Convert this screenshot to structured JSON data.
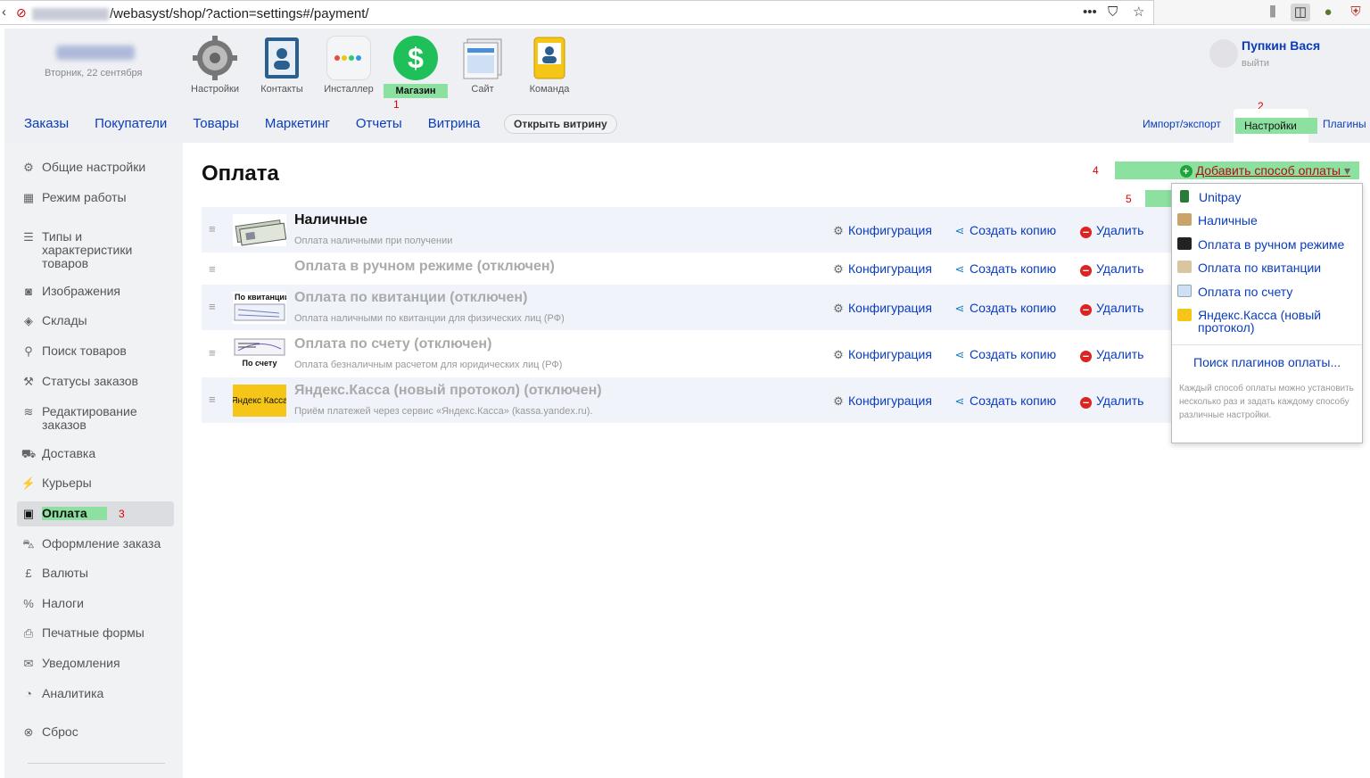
{
  "browser": {
    "url_path": "/webasyst/shop/?action=settings#/payment/",
    "icons": [
      "back-arrow-icon",
      "insecure-lock-icon",
      "more-dots-icon",
      "pocket-icon",
      "bookmark-star-icon",
      "library-icon",
      "sidebar-icon",
      "extension-icon",
      "shield-icon"
    ]
  },
  "account": {
    "date": "Вторник, 22 сентября"
  },
  "apps": [
    {
      "label": "Настройки",
      "icon": "gear-icon"
    },
    {
      "label": "Контакты",
      "icon": "contacts-icon"
    },
    {
      "label": "Инсталлер",
      "icon": "installer-icon"
    },
    {
      "label": "Магазин",
      "icon": "shop-dollar-icon"
    },
    {
      "label": "Сайт",
      "icon": "site-icon"
    },
    {
      "label": "Команда",
      "icon": "team-icon"
    }
  ],
  "user": {
    "name": "Пупкин Вася",
    "logout": "выйти"
  },
  "annotations": {
    "n1": "1",
    "n2": "2",
    "n3": "3",
    "n4": "4",
    "n5": "5"
  },
  "nav": {
    "items": [
      "Заказы",
      "Покупатели",
      "Товары",
      "Маркетинг",
      "Отчеты",
      "Витрина"
    ],
    "open_store": "Открыть витрину",
    "right": [
      "Импорт/экспорт",
      "Настройки",
      "Плагины"
    ]
  },
  "sidebar": {
    "items": [
      {
        "label": "Общие настройки",
        "icon": "settings-icon"
      },
      {
        "label": "Режим работы",
        "icon": "calendar-icon"
      },
      {
        "label": "Типы и характеристики товаров",
        "icon": "list-icon"
      },
      {
        "label": "Изображения",
        "icon": "camera-icon"
      },
      {
        "label": "Склады",
        "icon": "box-icon"
      },
      {
        "label": "Поиск товаров",
        "icon": "search-icon"
      },
      {
        "label": "Статусы заказов",
        "icon": "wrench-icon"
      },
      {
        "label": "Редактирование заказов",
        "icon": "layers-icon"
      },
      {
        "label": "Доставка",
        "icon": "truck-icon"
      },
      {
        "label": "Курьеры",
        "icon": "runner-icon"
      },
      {
        "label": "Оплата",
        "icon": "money-icon"
      },
      {
        "label": "Оформление заказа",
        "icon": "cart-icon"
      },
      {
        "label": "Валюты",
        "icon": "pound-icon"
      },
      {
        "label": "Налоги",
        "icon": "percent-icon"
      },
      {
        "label": "Печатные формы",
        "icon": "printer-icon"
      },
      {
        "label": "Уведомления",
        "icon": "mail-icon"
      },
      {
        "label": "Аналитика",
        "icon": "analytics-icon"
      },
      {
        "label": "Сброс",
        "icon": "reset-icon"
      }
    ],
    "active": "Оплата"
  },
  "page": {
    "title": "Оплата",
    "add_button": "Добавить способ оплаты"
  },
  "actions": {
    "configure": "Конфигурация",
    "copy": "Создать копию",
    "delete": "Удалить"
  },
  "payments": [
    {
      "name": "Наличные",
      "desc": "Оплата наличными при получении",
      "enabled": true,
      "thumb": "cash-thumb"
    },
    {
      "name": "Оплата в ручном режиме (отключен)",
      "desc": "",
      "enabled": false,
      "thumb": ""
    },
    {
      "name": "Оплата по квитанции (отключен)",
      "desc": "Оплата наличными по квитанции для физических лиц (РФ)",
      "enabled": false,
      "thumb": "receipt-thumb",
      "thumb_text": "По квитанции"
    },
    {
      "name": "Оплата по счету (отключен)",
      "desc": "Оплата безналичным расчетом для юридических лиц (РФ)",
      "enabled": false,
      "thumb": "invoice-thumb",
      "thumb_text": "По счету"
    },
    {
      "name": "Яндекс.Касса (новый протокол) (отключен)",
      "desc": "Приём платежей через сервис «Яндекс.Касса» (kassa.yandex.ru).",
      "enabled": false,
      "thumb": "yandex-thumb",
      "thumb_text": "Яндекс Касса"
    }
  ],
  "dropdown": {
    "items": [
      {
        "label": "Unitpay",
        "icon": "phone-icon"
      },
      {
        "label": "Наличные",
        "icon": "cash-icon"
      },
      {
        "label": "Оплата в ручном режиме",
        "icon": "money-icon"
      },
      {
        "label": "Оплата по квитанции",
        "icon": "receipt-icon"
      },
      {
        "label": "Оплата по счету",
        "icon": "document-icon"
      },
      {
        "label": "Яндекс.Касса (новый протокол)",
        "icon": "yandex-icon"
      }
    ],
    "search_plugins": "Поиск плагинов оплаты...",
    "hint": "Каждый способ оплаты можно установить несколько раз и задать каждому способу различные настройки."
  },
  "colors": {
    "link": "#0a3cbd",
    "highlight": "#8ce0a0",
    "annotation": "#dd0000",
    "add_button_text": "#aa1111"
  }
}
